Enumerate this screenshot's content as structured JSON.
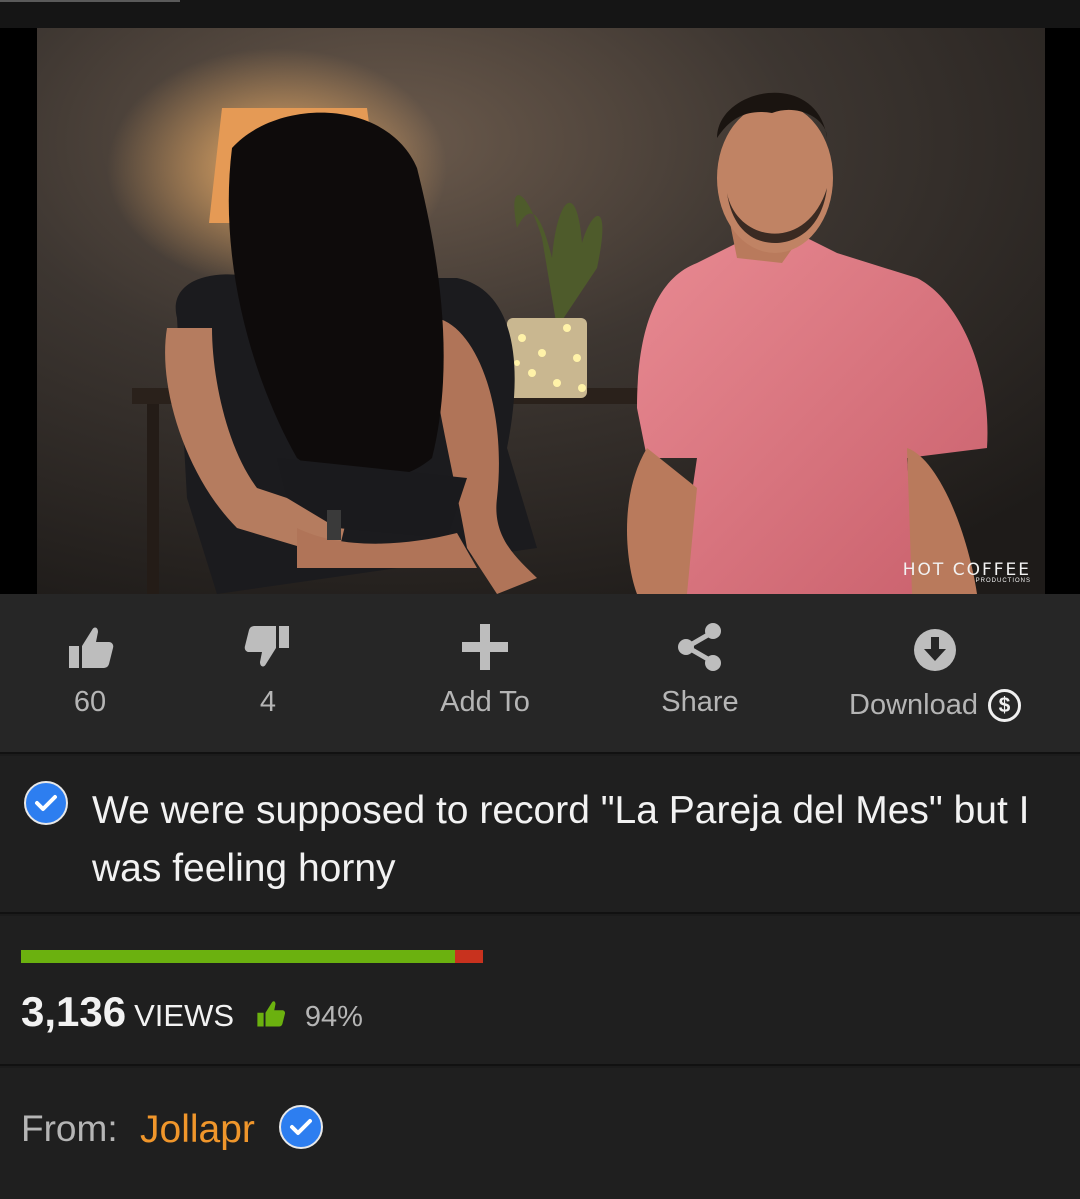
{
  "video": {
    "watermark": "HOT COFFEE",
    "watermark_sub": "PRODUCTIONS"
  },
  "actions": {
    "likes": "60",
    "dislikes": "4",
    "add_to": "Add To",
    "share": "Share",
    "download": "Download",
    "download_badge": "$"
  },
  "video_info": {
    "title": "We were supposed to record \"La Pareja del Mes\" but I was feeling horny",
    "rating_fraction": 0.94,
    "views_count": "3,136",
    "views_word": "VIEWS",
    "rating_percent": "94%"
  },
  "uploader": {
    "from_label": "From:",
    "name": "Jollapr"
  },
  "colors": {
    "background": "#1f1f1f",
    "action_bar": "#262626",
    "rating_good": "#6bb10f",
    "rating_bad": "#c8321e",
    "uploader_link": "#f0962b",
    "verified_blue": "#2d7ef0"
  },
  "icons": [
    "thumbs-up-icon",
    "thumbs-down-icon",
    "plus-icon",
    "share-icon",
    "download-circle-icon",
    "dollar-circle-icon",
    "verified-check-icon"
  ]
}
